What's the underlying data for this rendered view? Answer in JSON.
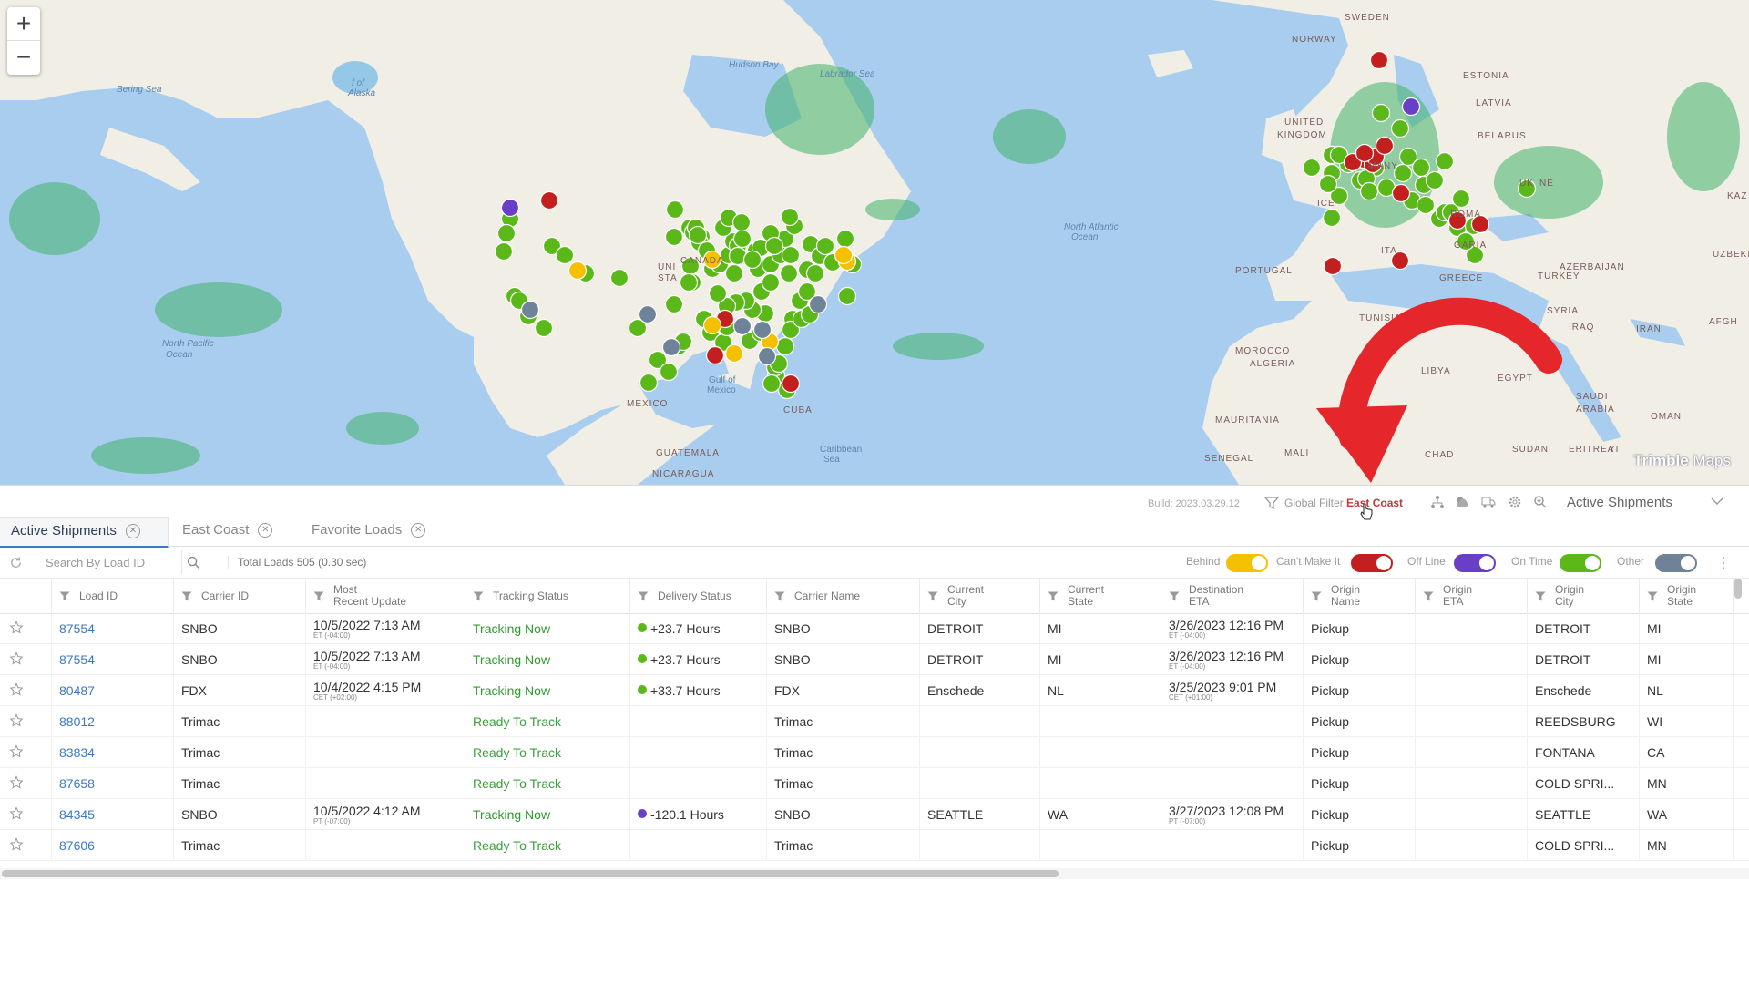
{
  "map": {
    "zoom_in": "+",
    "zoom_out": "−",
    "logo_brand": "Trimble",
    "logo_suffix": "Maps",
    "labels": [
      {
        "text": "SWEDEN"
      },
      {
        "text": "NORWAY"
      },
      {
        "text": "ESTONIA"
      },
      {
        "text": "LATVIA"
      },
      {
        "text": "UNITED"
      },
      {
        "text": "KINGDOM"
      },
      {
        "text": "BELARUS"
      },
      {
        "text": "ICE"
      },
      {
        "text": "MANY"
      },
      {
        "text": "ITA"
      },
      {
        "text": "PORTUGAL"
      },
      {
        "text": "ROMA"
      },
      {
        "text": "GARIA"
      },
      {
        "text": "GREECE"
      },
      {
        "text": "TURKEY"
      },
      {
        "text": "UK"
      },
      {
        "text": "NE"
      },
      {
        "text": "AZERBAIJAN"
      },
      {
        "text": "UZBEKIS"
      },
      {
        "text": "KAZ"
      },
      {
        "text": "SYRIA"
      },
      {
        "text": "IRAQ"
      },
      {
        "text": "IRAN"
      },
      {
        "text": "AFGH"
      },
      {
        "text": "TUNISIA"
      },
      {
        "text": "MOROCCO"
      },
      {
        "text": "ALGERIA"
      },
      {
        "text": "LIBYA"
      },
      {
        "text": "EGYPT"
      },
      {
        "text": "SAUDI"
      },
      {
        "text": "ARABIA"
      },
      {
        "text": "OMAN"
      },
      {
        "text": "MAURITANIA"
      },
      {
        "text": "MALI"
      },
      {
        "text": "SENEGAL"
      },
      {
        "text": "CHAD"
      },
      {
        "text": "SUDAN"
      },
      {
        "text": "ERITREA"
      },
      {
        "text": "YI"
      },
      {
        "text": "CANADA"
      },
      {
        "text": "UNI"
      },
      {
        "text": "STA"
      },
      {
        "text": "MEXICO"
      },
      {
        "text": "CUBA"
      },
      {
        "text": "GUATEMALA"
      },
      {
        "text": "NICARAGUA"
      },
      {
        "text": "Alaska"
      },
      {
        "text": "Hudson Bay"
      },
      {
        "text": "Labrador Sea"
      },
      {
        "text": "Bering Sea"
      },
      {
        "text": "North Atlantic"
      },
      {
        "text": "Ocean"
      },
      {
        "text": "North Pacific"
      },
      {
        "text": "Ocean"
      },
      {
        "text": "Gulf of"
      },
      {
        "text": "Mexico"
      },
      {
        "text": "Caribbean"
      },
      {
        "text": "Sea"
      },
      {
        "text": "f of"
      }
    ]
  },
  "header": {
    "build": "Build: 2023.03.29.12",
    "filter_label": "Global Filter",
    "filter_value": "East Coast",
    "view_selector": "Active Shipments"
  },
  "tabs": [
    {
      "label": "Active Shipments",
      "active": true
    },
    {
      "label": "East Coast",
      "active": false
    },
    {
      "label": "Favorite Loads",
      "active": false
    }
  ],
  "toolbar": {
    "search_placeholder": "Search By Load ID",
    "total_loads": "Total Loads 505 (0.30 sec)",
    "legend": [
      {
        "label": "Behind",
        "color": "#f5c000"
      },
      {
        "label": "Can't Make It",
        "color": "#c41f1f"
      },
      {
        "label": "Off Line",
        "color": "#6a3fc8"
      },
      {
        "label": "On Time",
        "color": "#5bb819"
      },
      {
        "label": "Other",
        "color": "#6f8398"
      }
    ]
  },
  "columns": [
    {
      "label": "Load ID"
    },
    {
      "label": "Carrier ID"
    },
    {
      "label": "Most Recent Update",
      "l1": "Most",
      "l2": "Recent Update"
    },
    {
      "label": "Tracking Status"
    },
    {
      "label": "Delivery Status"
    },
    {
      "label": "Carrier Name"
    },
    {
      "label": "Current City",
      "l1": "Current",
      "l2": "City"
    },
    {
      "label": "Current State",
      "l1": "Current",
      "l2": "State"
    },
    {
      "label": "Destination ETA",
      "l1": "Destination",
      "l2": "ETA"
    },
    {
      "label": "Origin Name",
      "l1": "Origin",
      "l2": "Name"
    },
    {
      "label": "Origin ETA",
      "l1": "Origin",
      "l2": "ETA"
    },
    {
      "label": "Origin City",
      "l1": "Origin",
      "l2": "City"
    },
    {
      "label": "Origin State",
      "l1": "Origin",
      "l2": "State"
    }
  ],
  "rows": [
    {
      "load_id": "87554",
      "carrier_id": "SNBO",
      "update": "10/5/2022  7:13 AM",
      "update_tz": "ET (-04:00)",
      "tracking": "Tracking Now",
      "delivery": "+23.7 Hours",
      "delivery_color": "#5bb819",
      "carrier_name": "SNBO",
      "city": "DETROIT",
      "state": "MI",
      "dest_eta": "3/26/2023  12:16 PM",
      "dest_tz": "ET (-04:00)",
      "origin_name": "Pickup",
      "origin_eta": "",
      "origin_city": "DETROIT",
      "origin_state": "MI"
    },
    {
      "load_id": "87554",
      "carrier_id": "SNBO",
      "update": "10/5/2022  7:13 AM",
      "update_tz": "ET (-04:00)",
      "tracking": "Tracking Now",
      "delivery": "+23.7 Hours",
      "delivery_color": "#5bb819",
      "carrier_name": "SNBO",
      "city": "DETROIT",
      "state": "MI",
      "dest_eta": "3/26/2023  12:16 PM",
      "dest_tz": "ET (-04:00)",
      "origin_name": "Pickup",
      "origin_eta": "",
      "origin_city": "DETROIT",
      "origin_state": "MI"
    },
    {
      "load_id": "80487",
      "carrier_id": "FDX",
      "update": "10/4/2022  4:15 PM",
      "update_tz": "CET (+02:00)",
      "tracking": "Tracking Now",
      "delivery": "+33.7 Hours",
      "delivery_color": "#5bb819",
      "carrier_name": "FDX",
      "city": "Enschede",
      "state": "NL",
      "dest_eta": "3/25/2023  9:01 PM",
      "dest_tz": "CET (+01:00)",
      "origin_name": "Pickup",
      "origin_eta": "",
      "origin_city": "Enschede",
      "origin_state": "NL"
    },
    {
      "load_id": "88012",
      "carrier_id": "Trimac",
      "update": "",
      "update_tz": "",
      "tracking": "Ready To Track",
      "delivery": "",
      "delivery_color": "",
      "carrier_name": "Trimac",
      "city": "",
      "state": "",
      "dest_eta": "",
      "dest_tz": "",
      "origin_name": "Pickup",
      "origin_eta": "",
      "origin_city": "REEDSBURG",
      "origin_state": "WI"
    },
    {
      "load_id": "83834",
      "carrier_id": "Trimac",
      "update": "",
      "update_tz": "",
      "tracking": "Ready To Track",
      "delivery": "",
      "delivery_color": "",
      "carrier_name": "Trimac",
      "city": "",
      "state": "",
      "dest_eta": "",
      "dest_tz": "",
      "origin_name": "Pickup",
      "origin_eta": "",
      "origin_city": "FONTANA",
      "origin_state": "CA"
    },
    {
      "load_id": "87658",
      "carrier_id": "Trimac",
      "update": "",
      "update_tz": "",
      "tracking": "Ready To Track",
      "delivery": "",
      "delivery_color": "",
      "carrier_name": "Trimac",
      "city": "",
      "state": "",
      "dest_eta": "",
      "dest_tz": "",
      "origin_name": "Pickup",
      "origin_eta": "",
      "origin_city": "COLD SPRI...",
      "origin_state": "MN"
    },
    {
      "load_id": "84345",
      "carrier_id": "SNBO",
      "update": "10/5/2022  4:12 AM",
      "update_tz": "PT (-07:00)",
      "tracking": "Tracking Now",
      "delivery": "-120.1 Hours",
      "delivery_color": "#6a3fc8",
      "carrier_name": "SNBO",
      "city": "SEATTLE",
      "state": "WA",
      "dest_eta": "3/27/2023  12:08 PM",
      "dest_tz": "PT (-07:00)",
      "origin_name": "Pickup",
      "origin_eta": "",
      "origin_city": "SEATTLE",
      "origin_state": "WA"
    },
    {
      "load_id": "87606",
      "carrier_id": "Trimac",
      "update": "",
      "update_tz": "",
      "tracking": "Ready To Track",
      "delivery": "",
      "delivery_color": "",
      "carrier_name": "Trimac",
      "city": "",
      "state": "",
      "dest_eta": "",
      "dest_tz": "",
      "origin_name": "Pickup",
      "origin_eta": "",
      "origin_city": "COLD SPRI...",
      "origin_state": "MN"
    }
  ],
  "colors": {
    "accent": "#3b78c4",
    "on_time": "#5bb819",
    "behind": "#f5c000",
    "cant_make_it": "#c41f1f",
    "off_line": "#6a3fc8",
    "other": "#6f8398",
    "annotation_arrow": "#e5262b"
  }
}
